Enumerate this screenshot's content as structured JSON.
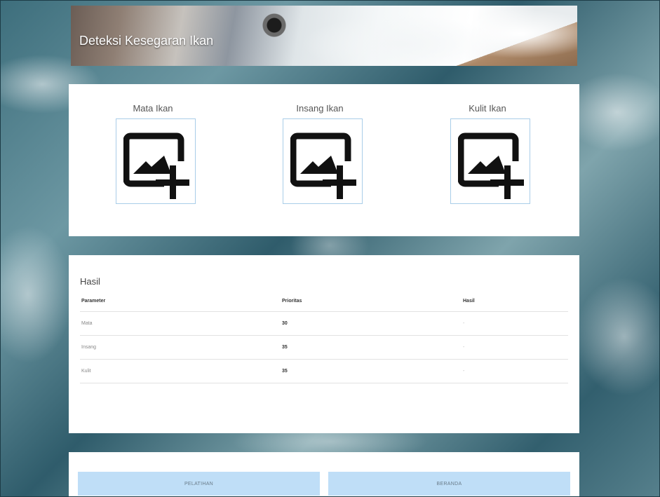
{
  "header": {
    "title": "Deteksi Kesegaran Ikan"
  },
  "uploads": [
    {
      "label": "Mata Ikan",
      "icon": "add-photo-icon"
    },
    {
      "label": "Insang Ikan",
      "icon": "add-photo-icon"
    },
    {
      "label": "Kulit Ikan",
      "icon": "add-photo-icon"
    }
  ],
  "results": {
    "title": "Hasil",
    "columns": [
      "Parameter",
      "Prioritas",
      "Hasil"
    ],
    "rows": [
      {
        "parameter": "Mata",
        "prioritas": "30",
        "hasil": "-"
      },
      {
        "parameter": "Insang",
        "prioritas": "35",
        "hasil": "-"
      },
      {
        "parameter": "Kulit",
        "prioritas": "35",
        "hasil": "-"
      }
    ]
  },
  "buttons": {
    "left_label": "PELATIHAN",
    "right_label": "BERANDA"
  },
  "colors": {
    "button_bg": "#bfdef7",
    "upload_border": "#a9cde8",
    "card_bg": "#ffffff"
  }
}
